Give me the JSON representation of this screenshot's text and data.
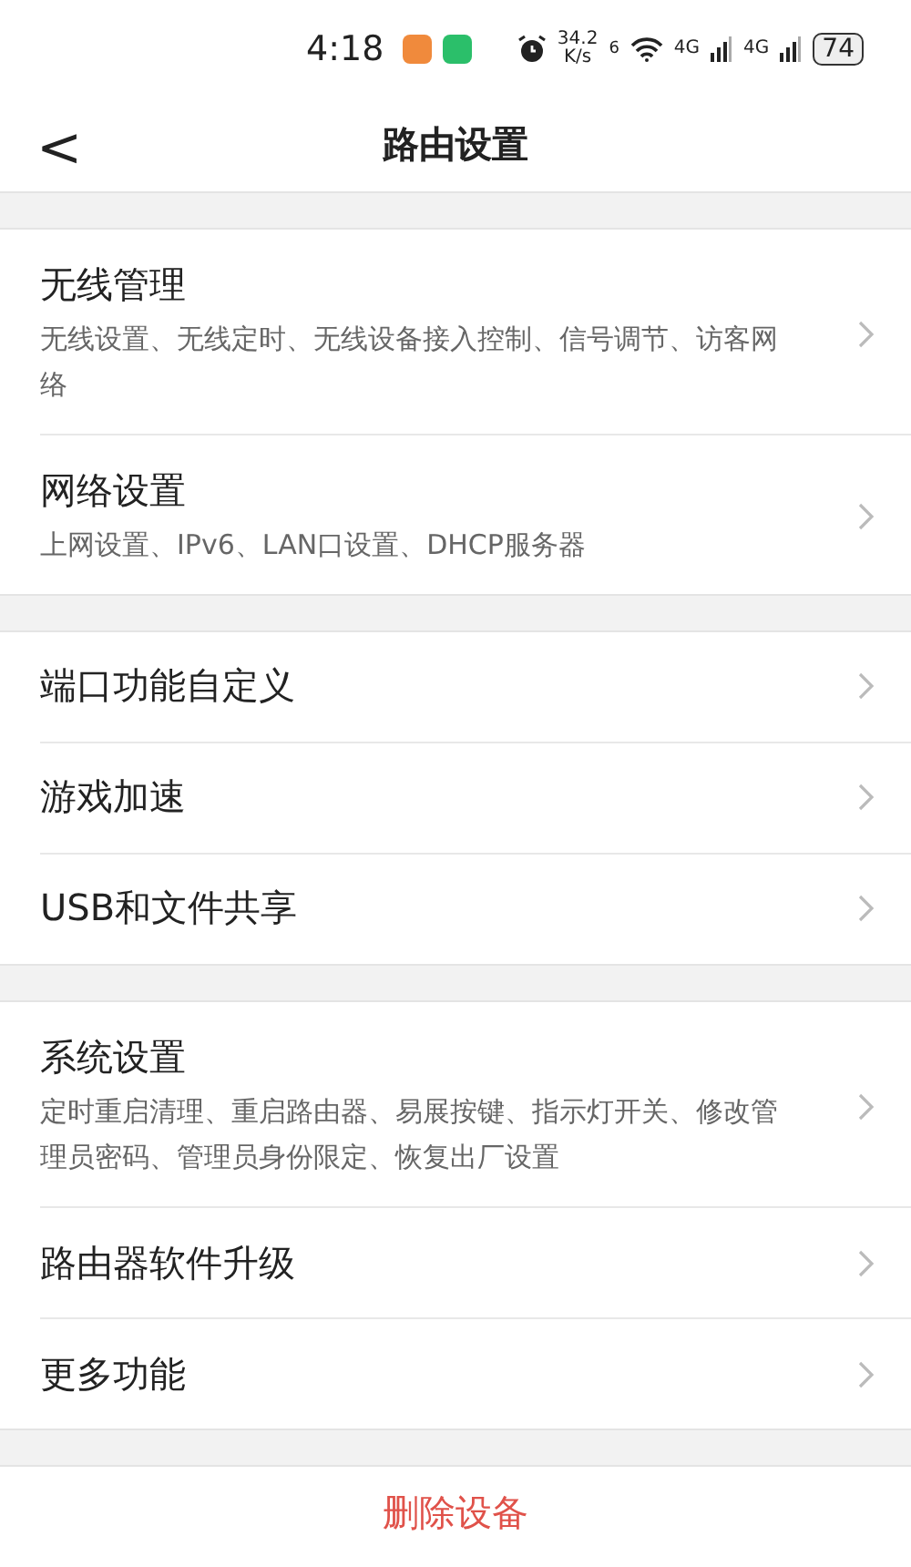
{
  "status_bar": {
    "time": "4:18",
    "speed": "34.2",
    "speed_unit": "K/s",
    "wifi_label": "6",
    "networks": [
      "4G",
      "4G"
    ],
    "battery": "74"
  },
  "header": {
    "back": "<",
    "title": "路由设置"
  },
  "groups": [
    {
      "items": [
        {
          "title": "无线管理",
          "description": "无线设置、无线定时、无线设备接入控制、信号调节、访客网络"
        },
        {
          "title": "网络设置",
          "description": "上网设置、IPv6、LAN口设置、DHCP服务器"
        }
      ]
    },
    {
      "items": [
        {
          "title": "端口功能自定义"
        },
        {
          "title": "游戏加速"
        },
        {
          "title": "USB和文件共享"
        }
      ]
    },
    {
      "items": [
        {
          "title": "系统设置",
          "description": "定时重启清理、重启路由器、易展按键、指示灯开关、修改管理员密码、管理员身份限定、恢复出厂设置"
        },
        {
          "title": "路由器软件升级"
        },
        {
          "title": "更多功能"
        }
      ]
    }
  ],
  "delete_button": "删除设备"
}
